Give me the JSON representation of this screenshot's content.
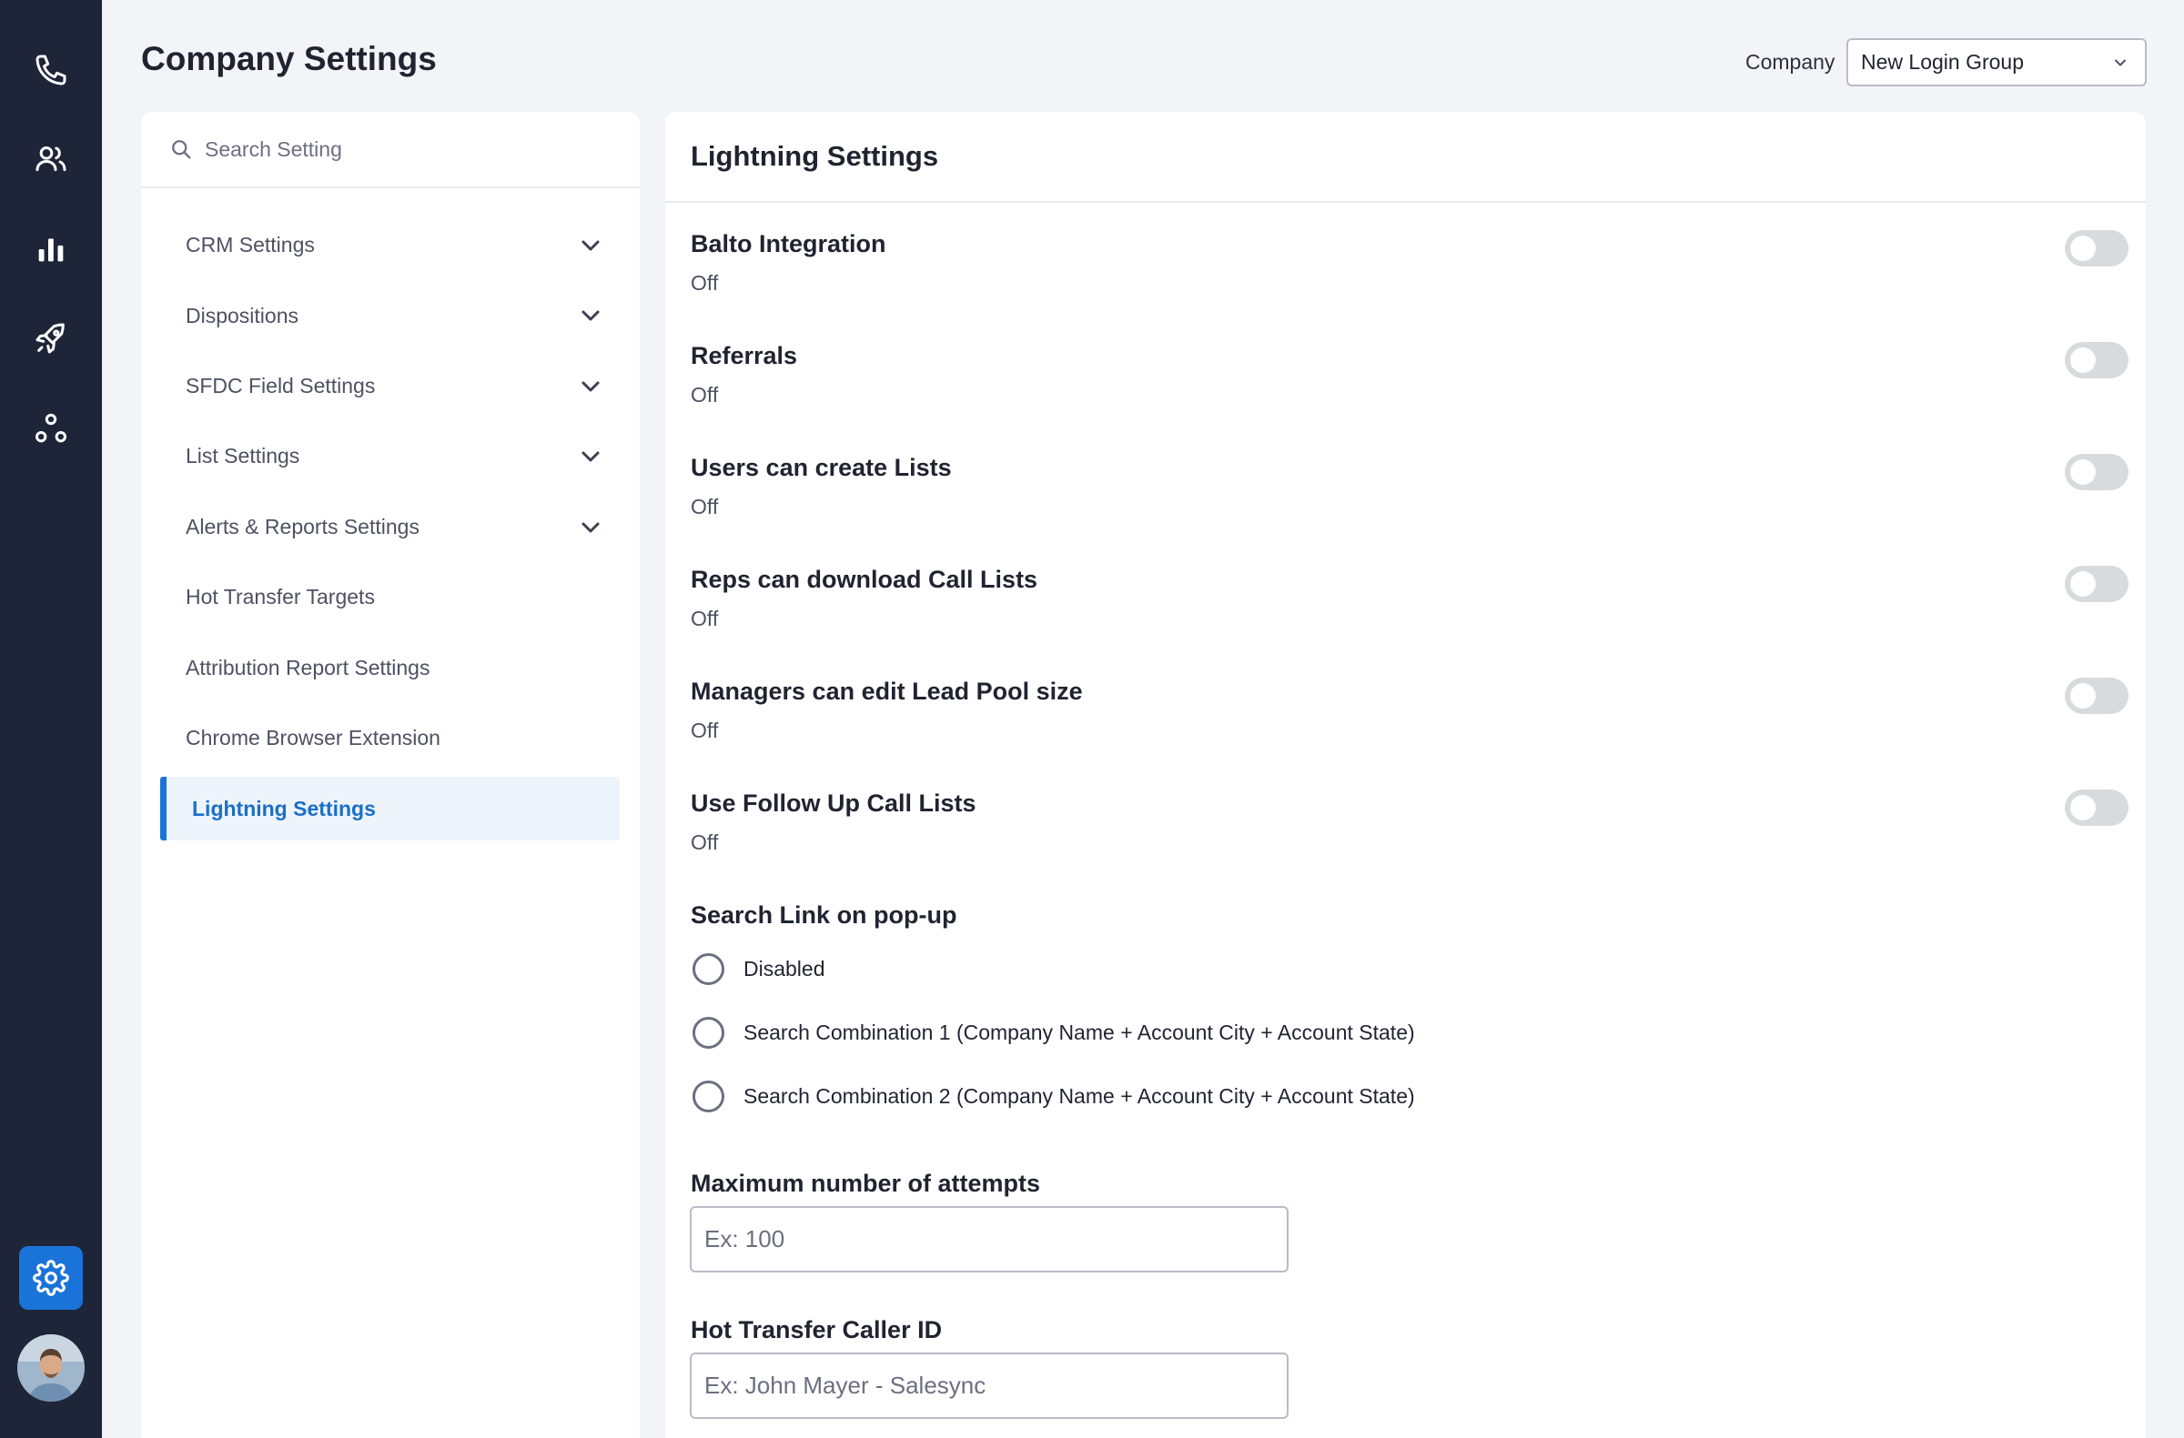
{
  "header": {
    "title": "Company Settings",
    "company_label": "Company",
    "company_value": "New Login Group"
  },
  "rail": {
    "items": [
      {
        "icon": "phone-icon"
      },
      {
        "icon": "contacts-icon"
      },
      {
        "icon": "bar-chart-icon"
      },
      {
        "icon": "rocket-icon"
      },
      {
        "icon": "org-chart-icon"
      }
    ],
    "settings_icon": "gear-icon",
    "colors": {
      "rail_bg": "#1e2538",
      "accent": "#1a73d9"
    }
  },
  "nav": {
    "search_placeholder": "Search Setting",
    "items": [
      {
        "label": "CRM Settings",
        "expandable": true
      },
      {
        "label": "Dispositions",
        "expandable": true
      },
      {
        "label": "SFDC Field Settings",
        "expandable": true
      },
      {
        "label": "List Settings",
        "expandable": true
      },
      {
        "label": "Alerts & Reports Settings",
        "expandable": true
      },
      {
        "label": "Hot Transfer Targets",
        "expandable": false
      },
      {
        "label": "Attribution Report Settings",
        "expandable": false
      },
      {
        "label": "Chrome Browser Extension",
        "expandable": false
      },
      {
        "label": "Lightning Settings",
        "expandable": false,
        "active": true
      }
    ]
  },
  "main": {
    "title": "Lightning Settings",
    "toggles": [
      {
        "label": "Balto Integration",
        "status": "Off"
      },
      {
        "label": "Referrals",
        "status": "Off"
      },
      {
        "label": "Users can create Lists",
        "status": "Off"
      },
      {
        "label": "Reps can download Call Lists",
        "status": "Off"
      },
      {
        "label": "Managers can edit Lead Pool size",
        "status": "Off"
      },
      {
        "label": "Use Follow Up Call Lists",
        "status": "Off"
      }
    ],
    "search_link": {
      "title": "Search Link on pop-up",
      "options": [
        "Disabled",
        "Search Combination 1 (Company Name + Account City + Account State)",
        "Search Combination 2 (Company Name + Account City + Account State)"
      ]
    },
    "max_attempts": {
      "label": "Maximum number of attempts",
      "placeholder": "Ex: 100",
      "value": ""
    },
    "caller_id": {
      "label": "Hot Transfer Caller ID",
      "placeholder": "Ex: John Mayer - Salesync",
      "value": ""
    }
  }
}
